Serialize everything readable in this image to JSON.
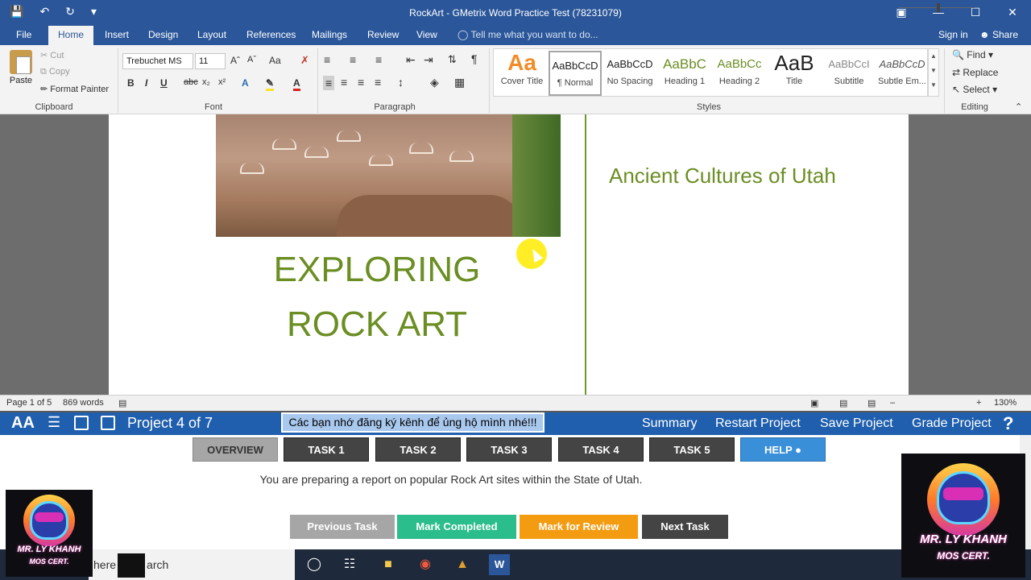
{
  "titlebar": {
    "title": "RockArt -  GMetrix Word Practice Test (78231079)"
  },
  "tabs": {
    "file": "File",
    "home": "Home",
    "insert": "Insert",
    "design": "Design",
    "layout": "Layout",
    "references": "References",
    "mailings": "Mailings",
    "review": "Review",
    "view": "View",
    "tell_me": "Tell me what you want to do...",
    "sign_in": "Sign in",
    "share": "Share"
  },
  "ribbon": {
    "clipboard": {
      "paste": "Paste",
      "cut": "Cut",
      "copy": "Copy",
      "format_painter": "Format Painter",
      "group_label": "Clipboard"
    },
    "font": {
      "font_name": "Trebuchet MS",
      "font_size": "11",
      "group_label": "Font",
      "case_label": "Aa"
    },
    "paragraph": {
      "group_label": "Paragraph"
    },
    "styles": {
      "group_label": "Styles",
      "items": [
        {
          "preview": "Aa",
          "name": "Cover Title"
        },
        {
          "preview": "AaBbCcD",
          "name": "¶ Normal"
        },
        {
          "preview": "AaBbCcD",
          "name": "No Spacing"
        },
        {
          "preview": "AaBbC",
          "name": "Heading 1"
        },
        {
          "preview": "AaBbCc",
          "name": "Heading 2"
        },
        {
          "preview": "AaB",
          "name": "Title"
        },
        {
          "preview": "AaBbCcI",
          "name": "Subtitle"
        },
        {
          "preview": "AaBbCcD",
          "name": "Subtle Em..."
        }
      ]
    },
    "editing": {
      "find": "Find",
      "replace": "Replace",
      "select": "Select",
      "group_label": "Editing"
    }
  },
  "document": {
    "heading_line1": "EXPLORING",
    "heading_line2": "ROCK ART",
    "side_title": "Ancient Cultures of Utah"
  },
  "status": {
    "page": "Page 1 of 5",
    "words": "869 words",
    "zoom": "130%"
  },
  "gmetrix": {
    "project": "Project 4 of 7",
    "banner": "Các bạn nhớ đăng ký kênh để ủng hộ mình nhé!!!",
    "summary": "Summary",
    "restart": "Restart Project",
    "save": "Save Project",
    "grade": "Grade Project",
    "help_icon": "?",
    "tasks": [
      "OVERVIEW",
      "TASK 1",
      "TASK 2",
      "TASK 3",
      "TASK 4",
      "TASK 5",
      "HELP"
    ],
    "description": "You are preparing a report on popular Rock Art sites within the State of Utah.",
    "previous": "Previous Task",
    "mark_completed": "Mark Completed",
    "mark_review": "Mark for Review",
    "next": "Next Task",
    "colors": {
      "bar": "#1f5fae",
      "mark_completed": "#2bbd8c",
      "mark_review": "#f39c12",
      "help": "#3a8fd9"
    }
  },
  "taskbar": {
    "search_left": "here",
    "search_right": "arch"
  },
  "logo": {
    "line1": "MR. LY KHANH",
    "line2": "MOS CERT."
  },
  "doc_colors": {
    "heading": "#6b8e23",
    "rule": "#6b9a2a"
  }
}
